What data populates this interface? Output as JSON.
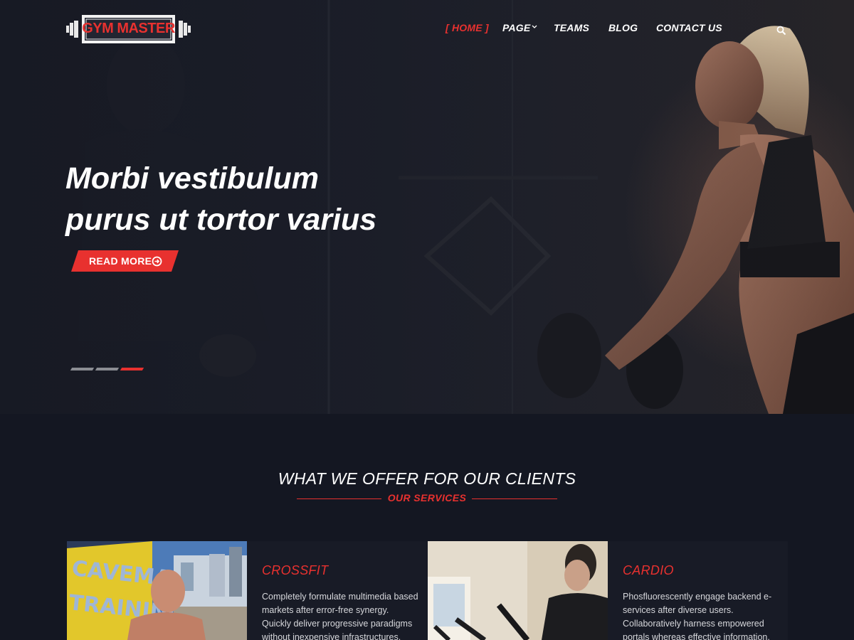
{
  "brand": {
    "logo_text": "GYM MASTER",
    "accent": "#e8312f"
  },
  "nav": {
    "items": [
      {
        "label": "[ HOME ]",
        "active": true
      },
      {
        "label": "PAGE",
        "has_dropdown": true
      },
      {
        "label": "TEAMS"
      },
      {
        "label": "BLOG"
      },
      {
        "label": "CONTACT US"
      }
    ],
    "search_icon": "search-icon"
  },
  "hero": {
    "title_line1": "Morbi vestibulum",
    "title_line2": "purus ut tortor varius",
    "cta_label": "READ MORE",
    "cta_icon": "arrow-circle-right-icon",
    "slides_total": 3,
    "active_slide": 3
  },
  "services": {
    "heading": "WHAT WE OFFER FOR OUR CLIENTS",
    "subheading": "OUR SERVICES",
    "cards": [
      {
        "title": "CROSSFIT",
        "text": "Completely formulate multimedia based markets after error-free synergy. Quickly deliver progressive paradigms without inexpensive infrastructures."
      },
      {
        "title": "CARDIO",
        "text": "Phosfluorescently engage backend e-services after diverse users. Collaboratively harness empowered portals whereas effective information."
      }
    ]
  }
}
